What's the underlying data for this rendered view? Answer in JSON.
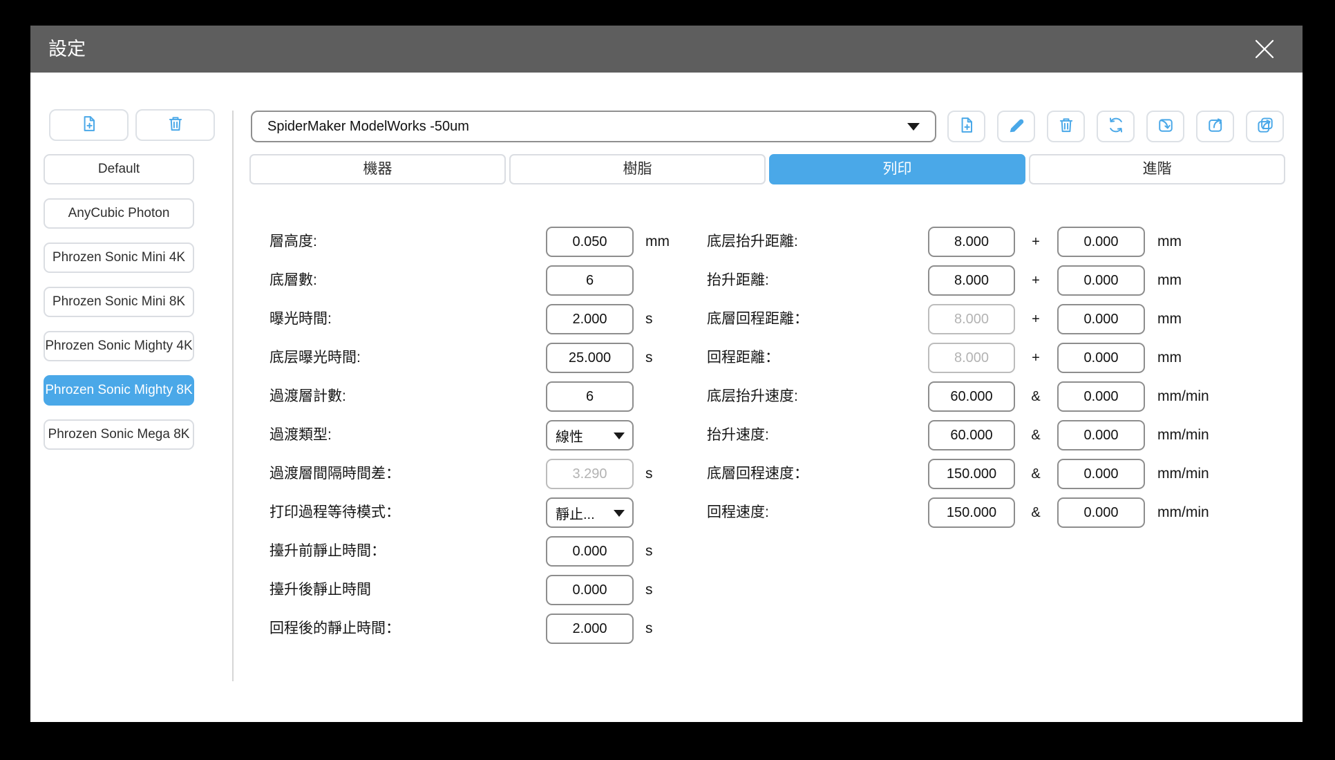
{
  "window": {
    "title": "設定"
  },
  "colors": {
    "accent": "#4aa8e8",
    "titlebar": "#5e5e5e"
  },
  "sidebar": {
    "actions": [
      {
        "name": "new-profile",
        "icon": "new-file-icon"
      },
      {
        "name": "delete-profile",
        "icon": "trash-icon"
      }
    ],
    "profiles": [
      {
        "label": "Default",
        "selected": false
      },
      {
        "label": "AnyCubic Photon",
        "selected": false
      },
      {
        "label": "Phrozen Sonic Mini 4K",
        "selected": false
      },
      {
        "label": "Phrozen Sonic Mini 8K",
        "selected": false
      },
      {
        "label": "Phrozen Sonic Mighty 4K",
        "selected": false
      },
      {
        "label": "Phrozen Sonic Mighty 8K",
        "selected": true
      },
      {
        "label": "Phrozen Sonic Mega 8K",
        "selected": false
      }
    ]
  },
  "toolbar": {
    "resin_profile": {
      "value": "SpiderMaker ModelWorks -50um"
    },
    "actions": [
      {
        "name": "add",
        "icon": "new-file-icon"
      },
      {
        "name": "edit",
        "icon": "pencil-icon"
      },
      {
        "name": "delete",
        "icon": "trash-icon"
      },
      {
        "name": "reset",
        "icon": "refresh-icon"
      },
      {
        "name": "import",
        "icon": "import-icon"
      },
      {
        "name": "export",
        "icon": "export-icon"
      },
      {
        "name": "export-all",
        "icon": "export-copy-icon"
      }
    ]
  },
  "tabs": [
    {
      "label": "機器",
      "active": false
    },
    {
      "label": "樹脂",
      "active": false
    },
    {
      "label": "列印",
      "active": true
    },
    {
      "label": "進階",
      "active": false
    }
  ],
  "form": {
    "left": [
      {
        "label": "層高度:",
        "type": "input",
        "value": "0.050",
        "unit": "mm",
        "disabled": false
      },
      {
        "label": "底層數:",
        "type": "input",
        "value": "6",
        "unit": "",
        "disabled": false
      },
      {
        "label": "曝光時間:",
        "type": "input",
        "value": "2.000",
        "unit": "s",
        "disabled": false
      },
      {
        "label": "底层曝光時間:",
        "type": "input",
        "value": "25.000",
        "unit": "s",
        "disabled": false
      },
      {
        "label": "過渡層計數:",
        "type": "input",
        "value": "6",
        "unit": "",
        "disabled": false
      },
      {
        "label": "過渡類型:",
        "type": "select",
        "value": "線性",
        "unit": "",
        "disabled": false
      },
      {
        "label": "過渡層間隔時間差：",
        "type": "input",
        "value": "3.290",
        "unit": "s",
        "disabled": true
      },
      {
        "label": "打印過程等待模式：",
        "type": "select",
        "value": "靜止...",
        "unit": "",
        "disabled": false
      },
      {
        "label": "擡升前靜止時間：",
        "type": "input",
        "value": "0.000",
        "unit": "s",
        "disabled": false
      },
      {
        "label": "擡升後靜止時間",
        "type": "input",
        "value": "0.000",
        "unit": "s",
        "disabled": false
      },
      {
        "label": "回程後的靜止時間：",
        "type": "input",
        "value": "2.000",
        "unit": "s",
        "disabled": false
      }
    ],
    "right": [
      {
        "label": "底层抬升距離:",
        "value1": "8.000",
        "joiner": "+",
        "value2": "0.000",
        "unit": "mm",
        "disabled1": false
      },
      {
        "label": "抬升距離:",
        "value1": "8.000",
        "joiner": "+",
        "value2": "0.000",
        "unit": "mm",
        "disabled1": false
      },
      {
        "label": "底層回程距離：",
        "value1": "8.000",
        "joiner": "+",
        "value2": "0.000",
        "unit": "mm",
        "disabled1": true
      },
      {
        "label": "回程距離：",
        "value1": "8.000",
        "joiner": "+",
        "value2": "0.000",
        "unit": "mm",
        "disabled1": true
      },
      {
        "label": "底层抬升速度:",
        "value1": "60.000",
        "joiner": "&",
        "value2": "0.000",
        "unit": "mm/min",
        "disabled1": false
      },
      {
        "label": "抬升速度:",
        "value1": "60.000",
        "joiner": "&",
        "value2": "0.000",
        "unit": "mm/min",
        "disabled1": false
      },
      {
        "label": "底層回程速度：",
        "value1": "150.000",
        "joiner": "&",
        "value2": "0.000",
        "unit": "mm/min",
        "disabled1": false
      },
      {
        "label": "回程速度:",
        "value1": "150.000",
        "joiner": "&",
        "value2": "0.000",
        "unit": "mm/min",
        "disabled1": false
      }
    ]
  }
}
